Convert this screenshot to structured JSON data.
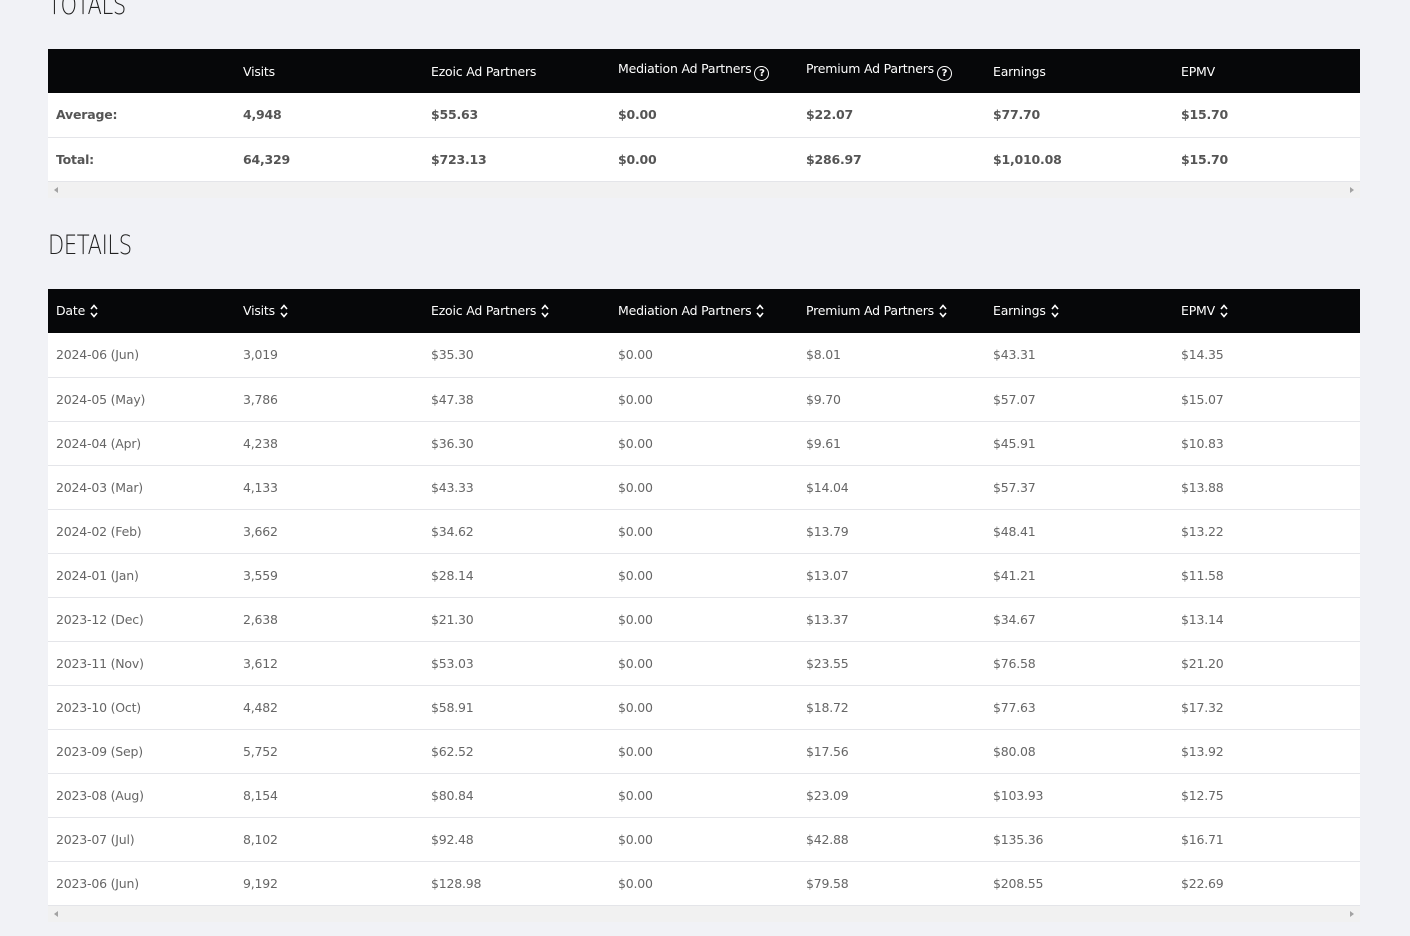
{
  "totals": {
    "title": "TOTALS",
    "columns": [
      "",
      "Visits",
      "Ezoic Ad Partners",
      "Mediation Ad Partners",
      "Premium Ad Partners",
      "Earnings",
      "EPMV"
    ],
    "help_columns": [
      3,
      4
    ],
    "rows": [
      [
        "Average:",
        "4,948",
        "$55.63",
        "$0.00",
        "$22.07",
        "$77.70",
        "$15.70"
      ],
      [
        "Total:",
        "64,329",
        "$723.13",
        "$0.00",
        "$286.97",
        "$1,010.08",
        "$15.70"
      ]
    ]
  },
  "details": {
    "title": "DETAILS",
    "columns": [
      "Date",
      "Visits",
      "Ezoic Ad Partners",
      "Mediation Ad Partners",
      "Premium Ad Partners",
      "Earnings",
      "EPMV"
    ],
    "rows": [
      [
        "2024-06 (Jun)",
        "3,019",
        "$35.30",
        "$0.00",
        "$8.01",
        "$43.31",
        "$14.35"
      ],
      [
        "2024-05 (May)",
        "3,786",
        "$47.38",
        "$0.00",
        "$9.70",
        "$57.07",
        "$15.07"
      ],
      [
        "2024-04 (Apr)",
        "4,238",
        "$36.30",
        "$0.00",
        "$9.61",
        "$45.91",
        "$10.83"
      ],
      [
        "2024-03 (Mar)",
        "4,133",
        "$43.33",
        "$0.00",
        "$14.04",
        "$57.37",
        "$13.88"
      ],
      [
        "2024-02 (Feb)",
        "3,662",
        "$34.62",
        "$0.00",
        "$13.79",
        "$48.41",
        "$13.22"
      ],
      [
        "2024-01 (Jan)",
        "3,559",
        "$28.14",
        "$0.00",
        "$13.07",
        "$41.21",
        "$11.58"
      ],
      [
        "2023-12 (Dec)",
        "2,638",
        "$21.30",
        "$0.00",
        "$13.37",
        "$34.67",
        "$13.14"
      ],
      [
        "2023-11 (Nov)",
        "3,612",
        "$53.03",
        "$0.00",
        "$23.55",
        "$76.58",
        "$21.20"
      ],
      [
        "2023-10 (Oct)",
        "4,482",
        "$58.91",
        "$0.00",
        "$18.72",
        "$77.63",
        "$17.32"
      ],
      [
        "2023-09 (Sep)",
        "5,752",
        "$62.52",
        "$0.00",
        "$17.56",
        "$80.08",
        "$13.92"
      ],
      [
        "2023-08 (Aug)",
        "8,154",
        "$80.84",
        "$0.00",
        "$23.09",
        "$103.93",
        "$12.75"
      ],
      [
        "2023-07 (Jul)",
        "8,102",
        "$92.48",
        "$0.00",
        "$42.88",
        "$135.36",
        "$16.71"
      ],
      [
        "2023-06 (Jun)",
        "9,192",
        "$128.98",
        "$0.00",
        "$79.58",
        "$208.55",
        "$22.69"
      ]
    ]
  },
  "icons": {
    "help": "question-circle-icon",
    "help_glyph": "?",
    "sort": "sort-icon"
  },
  "colors": {
    "header_bg": "#060709",
    "page_bg": "#f1f2f6"
  }
}
